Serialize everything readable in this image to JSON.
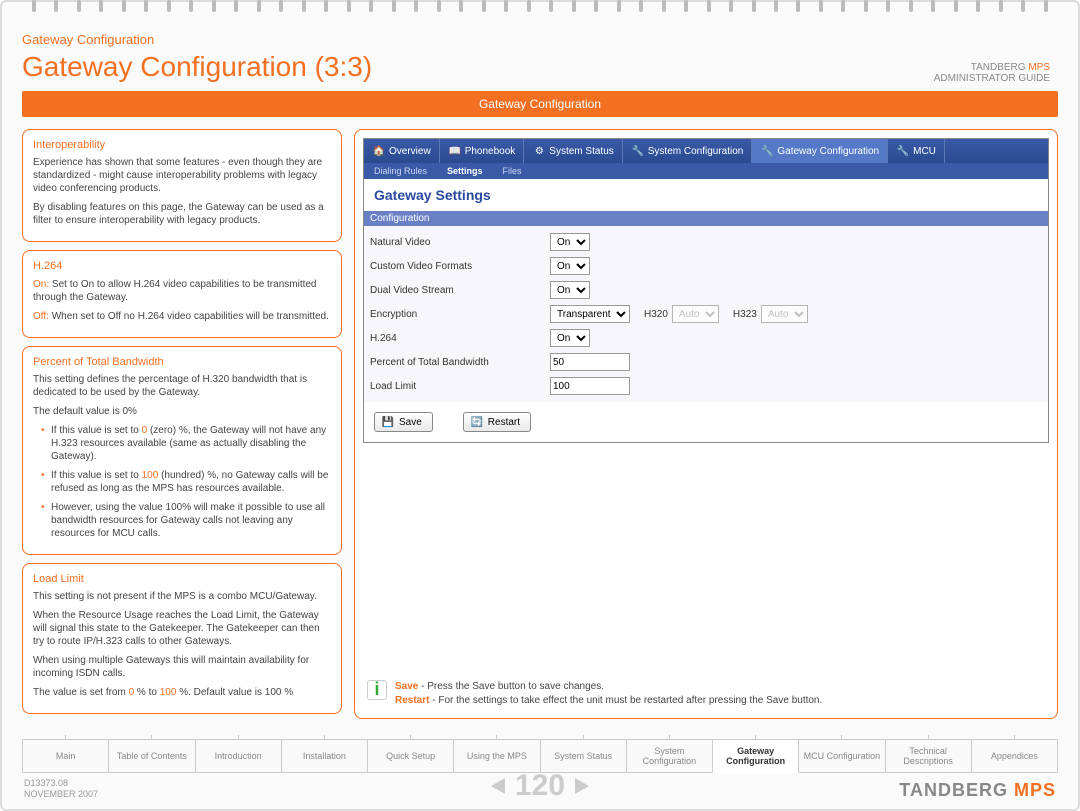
{
  "breadcrumb": "Gateway Configuration",
  "title": "Gateway Configuration (3:3)",
  "doc_brand_line1": "TANDBERG",
  "doc_brand_orange": "MPS",
  "doc_brand_line2": "ADMINISTRATOR GUIDE",
  "banner": "Gateway Configuration",
  "interop": {
    "heading": "Interoperability",
    "p1": "Experience has shown that some features - even though they are standardized - might cause interoperability problems with legacy video conferencing products.",
    "p2": "By disabling features on this page, the Gateway can be used as a filter to ensure interoperability with legacy products."
  },
  "h264": {
    "heading": "H.264",
    "on_label": "On:",
    "on_text": "Set to On to allow H.264 video capabilities to be transmitted through the Gateway.",
    "off_label": "Off:",
    "off_text": "When set to Off no H.264 video capabilities will be transmitted."
  },
  "percent": {
    "heading": "Percent of Total Bandwidth",
    "p1": "This setting defines the percentage of H.320 bandwidth that is dedicated to be used by the Gateway.",
    "p2": "The default value is 0%",
    "li1a": "If this value is set to ",
    "li1_zero": "0",
    "li1b": " (zero) %, the Gateway will not have any H.323 resources available (same as actually disabling the Gateway).",
    "li2a": "If this value is set to ",
    "li2_hundred": "100",
    "li2b": " (hundred) %, no Gateway calls will be refused as long as the MPS has resources available.",
    "li3": "However, using the value 100% will make it possible to use all bandwidth resources for Gateway calls not leaving any resources for MCU calls."
  },
  "loadlimit": {
    "heading": "Load Limit",
    "p1": "This setting is not present if the MPS is a combo MCU/Gateway.",
    "p2": "When the Resource Usage reaches the Load Limit, the Gateway will signal this state to the Gatekeeper. The Gatekeeper can then try to route IP/H.323 calls to other Gateways.",
    "p3": "When using multiple Gateways this will maintain availability for incoming ISDN calls.",
    "p4a": "The value is set from ",
    "p4_zero": "0",
    "p4b": " % to ",
    "p4_hundred": "100",
    "p4c": " %. Default value is 100 %"
  },
  "screenshot": {
    "tabs": [
      "Overview",
      "Phonebook",
      "System Status",
      "System Configuration",
      "Gateway Configuration",
      "MCU"
    ],
    "subtabs": [
      "Dialing Rules",
      "Settings",
      "Files"
    ],
    "section": "Gateway Settings",
    "config_label": "Configuration",
    "rows": {
      "natural_video": {
        "label": "Natural Video",
        "value": "On"
      },
      "custom_video": {
        "label": "Custom Video Formats",
        "value": "On"
      },
      "dual_video": {
        "label": "Dual Video Stream",
        "value": "On"
      },
      "encryption": {
        "label": "Encryption",
        "value": "Transparent",
        "extra_h320": "H320",
        "extra_auto1": "Auto",
        "extra_h323": "H323",
        "extra_auto2": "Auto"
      },
      "h264": {
        "label": "H.264",
        "value": "On"
      },
      "percent": {
        "label": "Percent of Total Bandwidth",
        "value": "50"
      },
      "loadlimit": {
        "label": "Load Limit",
        "value": "100"
      }
    },
    "save_btn": "Save",
    "restart_btn": "Restart"
  },
  "notes": {
    "save_bold": "Save",
    "save_text": " - Press the Save button to save changes.",
    "restart_bold": "Restart",
    "restart_text": " - For the settings to take effect the unit must be restarted after pressing the Save button."
  },
  "bottom_tabs": [
    "Main",
    "Table of Contents",
    "Introduction",
    "Installation",
    "Quick Setup",
    "Using the MPS",
    "System Status",
    "System Configuration",
    "Gateway Configuration",
    "MCU Configuration",
    "Technical Descriptions",
    "Appendices"
  ],
  "bottom_active_index": 8,
  "docid": "D13373.08",
  "docdate": "NOVEMBER 2007",
  "page": "120",
  "brand1": "TANDBERG",
  "brand2": "MPS"
}
